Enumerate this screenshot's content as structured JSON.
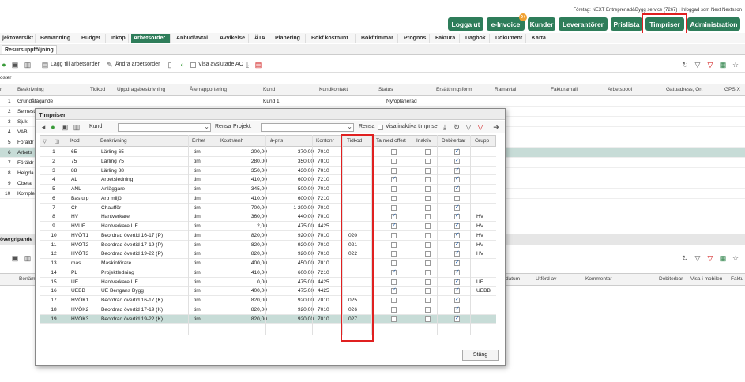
{
  "header": {
    "company_line": "Företag: NEXT Entreprenad&Bygg service (7267) | Inloggad som Next Nextsson",
    "buttons": [
      {
        "label": "Logga ut"
      },
      {
        "label": "e-Invoice",
        "badge": "9+"
      },
      {
        "label": "Kunder"
      },
      {
        "label": "Leverantörer"
      },
      {
        "label": "Prislista"
      },
      {
        "label": "Timpriser"
      },
      {
        "label": "Administration"
      }
    ],
    "accent": "#2e7d5a",
    "highlight": "#e02020"
  },
  "nav": {
    "tabs": [
      "jektöversikt",
      "Bemanning",
      "Budget",
      "Inköp",
      "Arbetsorder",
      "Anbud/avtal",
      "Avvikelse",
      "ÄTA",
      "Planering",
      "Bokf kostn/Int",
      "Bokf timmar",
      "Prognos",
      "Faktura",
      "Dagbok",
      "Dokument",
      "Karta"
    ],
    "active": "Arbetsorder",
    "subtab": "Resursuppföljning"
  },
  "toolbar": {
    "add_label": "Lägg till arbetsorder",
    "edit_label": "Ändra arbetsorder",
    "show_done_label": "Visa avslutade AO"
  },
  "background": {
    "section_label": "oster",
    "columns": [
      "r",
      "Beskrivning",
      "Tidkod",
      "Uppdragsbeskrivning",
      "Återrapportering",
      "Kund",
      "Kundkontakt",
      "Status",
      "Ersättningsform",
      "Ramavtal",
      "Fakturamall",
      "Arbetspool",
      "Gatuadress, Ort",
      "GPS X"
    ],
    "rows": [
      {
        "n": "1",
        "desc": "Grundåtagande",
        "kund": "Kund 1",
        "status": "Ny/oplanerad"
      },
      {
        "n": "2",
        "desc": "Semest"
      },
      {
        "n": "3",
        "desc": "Sjuk"
      },
      {
        "n": "4",
        "desc": "VAB"
      },
      {
        "n": "5",
        "desc": "Föräldr"
      },
      {
        "n": "6",
        "desc": "Arbets"
      },
      {
        "n": "7",
        "desc": "Föräldr"
      },
      {
        "n": "8",
        "desc": "Helgda"
      },
      {
        "n": "9",
        "desc": "Obetal"
      },
      {
        "n": "10",
        "desc": "Komple"
      }
    ],
    "section2_label": "övergripande",
    "grid2_columns": [
      "Benäm",
      "datum",
      "Utförd av",
      "Kommentar",
      "Debiterbar",
      "Visa i mobilen",
      "Faktu"
    ]
  },
  "dialog": {
    "title": "Timpriser",
    "kund_label": "Kund:",
    "projekt_label": "Projekt:",
    "rensa": "Rensa",
    "show_inactive": "Visa inaktiva timpriser",
    "columns": [
      "Kod",
      "Beskrivning",
      "Enhet",
      "Kostn/enh",
      "à-pris",
      "Kontonr",
      "Tidkod",
      "Ta med offert",
      "Inaktiv",
      "Debiterbar",
      "Grupp"
    ],
    "close_label": "Stäng",
    "rows": [
      {
        "n": "1",
        "kod": "65",
        "desc": "Lärling 65",
        "enhet": "tim",
        "kostn": "200,00",
        "pris": "370,00",
        "konto": "7010",
        "tidkod": "",
        "offert": false,
        "inaktiv": false,
        "deb": true,
        "grupp": ""
      },
      {
        "n": "2",
        "kod": "75",
        "desc": "Lärling 75",
        "enhet": "tim",
        "kostn": "280,00",
        "pris": "350,00",
        "konto": "7010",
        "tidkod": "",
        "offert": false,
        "inaktiv": false,
        "deb": true,
        "grupp": ""
      },
      {
        "n": "3",
        "kod": "88",
        "desc": "Lärling 88",
        "enhet": "tim",
        "kostn": "350,00",
        "pris": "430,00",
        "konto": "7010",
        "tidkod": "",
        "offert": false,
        "inaktiv": false,
        "deb": true,
        "grupp": ""
      },
      {
        "n": "4",
        "kod": "AL",
        "desc": "Arbetsledning",
        "enhet": "tim",
        "kostn": "410,00",
        "pris": "600,00",
        "konto": "7210",
        "tidkod": "",
        "offert": true,
        "inaktiv": false,
        "deb": true,
        "grupp": ""
      },
      {
        "n": "5",
        "kod": "ANL",
        "desc": "Anläggare",
        "enhet": "tim",
        "kostn": "345,00",
        "pris": "500,00",
        "konto": "7010",
        "tidkod": "",
        "offert": false,
        "inaktiv": false,
        "deb": true,
        "grupp": ""
      },
      {
        "n": "6",
        "kod": "Bas u p",
        "desc": "Arb miljö",
        "enhet": "tim",
        "kostn": "410,00",
        "pris": "600,00",
        "konto": "7210",
        "tidkod": "",
        "offert": false,
        "inaktiv": false,
        "deb": false,
        "grupp": ""
      },
      {
        "n": "7",
        "kod": "Ch",
        "desc": "Chaufför",
        "enhet": "tim",
        "kostn": "700,00",
        "pris": "1 200,00",
        "konto": "7010",
        "tidkod": "",
        "offert": false,
        "inaktiv": false,
        "deb": true,
        "grupp": ""
      },
      {
        "n": "8",
        "kod": "HV",
        "desc": "Hantverkare",
        "enhet": "tim",
        "kostn": "360,00",
        "pris": "440,00",
        "konto": "7010",
        "tidkod": "",
        "offert": true,
        "inaktiv": false,
        "deb": true,
        "grupp": "HV"
      },
      {
        "n": "9",
        "kod": "HVUE",
        "desc": "Hantverkare UE",
        "enhet": "tim",
        "kostn": "2,00",
        "pris": "475,00",
        "konto": "4425",
        "tidkod": "",
        "offert": true,
        "inaktiv": false,
        "deb": true,
        "grupp": "HV"
      },
      {
        "n": "10",
        "kod": "HVÖT1",
        "desc": "Beordrad övertid 16-17 (P)",
        "enhet": "tim",
        "kostn": "820,00",
        "pris": "920,00",
        "konto": "7010",
        "tidkod": "020",
        "offert": false,
        "inaktiv": false,
        "deb": true,
        "grupp": "HV"
      },
      {
        "n": "11",
        "kod": "HVÖT2",
        "desc": "Beordrad övertid 17-19 (P)",
        "enhet": "tim",
        "kostn": "820,00",
        "pris": "920,00",
        "konto": "7010",
        "tidkod": "021",
        "offert": false,
        "inaktiv": false,
        "deb": true,
        "grupp": "HV"
      },
      {
        "n": "12",
        "kod": "HVÖT3",
        "desc": "Beordrad övertid 19-22 (P)",
        "enhet": "tim",
        "kostn": "820,00",
        "pris": "920,00",
        "konto": "7010",
        "tidkod": "022",
        "offert": false,
        "inaktiv": false,
        "deb": true,
        "grupp": "HV"
      },
      {
        "n": "13",
        "kod": "mas",
        "desc": "Maskinförare",
        "enhet": "tim",
        "kostn": "400,00",
        "pris": "450,00",
        "konto": "7010",
        "tidkod": "",
        "offert": false,
        "inaktiv": false,
        "deb": true,
        "grupp": ""
      },
      {
        "n": "14",
        "kod": "PL",
        "desc": "Projektledning",
        "enhet": "tim",
        "kostn": "410,00",
        "pris": "600,00",
        "konto": "7210",
        "tidkod": "",
        "offert": true,
        "inaktiv": false,
        "deb": true,
        "grupp": ""
      },
      {
        "n": "15",
        "kod": "UE",
        "desc": "Hantverkare UE",
        "enhet": "tim",
        "kostn": "0,00",
        "pris": "475,00",
        "konto": "4425",
        "tidkod": "",
        "offert": false,
        "inaktiv": false,
        "deb": true,
        "grupp": "UE"
      },
      {
        "n": "16",
        "kod": "UEBB",
        "desc": "UE Bengans Bygg",
        "enhet": "tim",
        "kostn": "400,00",
        "pris": "475,00",
        "konto": "4425",
        "tidkod": "",
        "offert": true,
        "inaktiv": false,
        "deb": true,
        "grupp": "UEBB"
      },
      {
        "n": "17",
        "kod": "HVÖK1",
        "desc": "Beordrad övertid 16-17 (K)",
        "enhet": "tim",
        "kostn": "820,00",
        "pris": "920,00",
        "konto": "7010",
        "tidkod": "025",
        "offert": false,
        "inaktiv": false,
        "deb": true,
        "grupp": ""
      },
      {
        "n": "18",
        "kod": "HVÖK2",
        "desc": "Beordrad övertid 17-19 (K)",
        "enhet": "tim",
        "kostn": "820,00",
        "pris": "920,00",
        "konto": "7010",
        "tidkod": "026",
        "offert": false,
        "inaktiv": false,
        "deb": true,
        "grupp": ""
      },
      {
        "n": "19",
        "kod": "HVÖK3",
        "desc": "Beordrad övertid 19-22 (K)",
        "enhet": "tim",
        "kostn": "820,00",
        "pris": "920,00",
        "konto": "7010",
        "tidkod": "027",
        "offert": false,
        "inaktiv": false,
        "deb": true,
        "grupp": ""
      }
    ]
  }
}
